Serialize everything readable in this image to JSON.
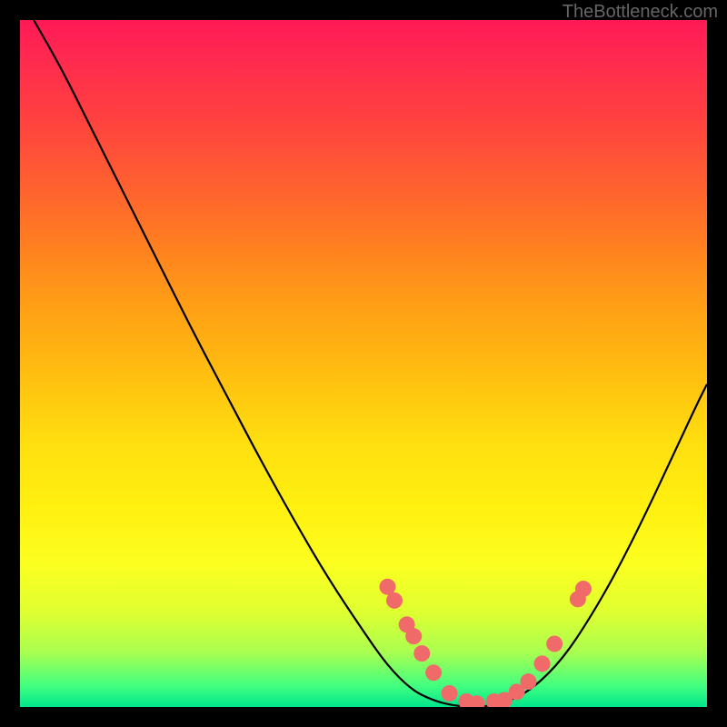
{
  "watermark": "TheBottleneck.com",
  "chart_data": {
    "type": "line",
    "title": "",
    "xlabel": "",
    "ylabel": "",
    "xlim": [
      0,
      1
    ],
    "ylim": [
      0,
      1
    ],
    "curve": [
      {
        "x": 0.02,
        "y": 1.0
      },
      {
        "x": 0.06,
        "y": 0.93
      },
      {
        "x": 0.1,
        "y": 0.85
      },
      {
        "x": 0.15,
        "y": 0.75
      },
      {
        "x": 0.2,
        "y": 0.65
      },
      {
        "x": 0.25,
        "y": 0.55
      },
      {
        "x": 0.3,
        "y": 0.455
      },
      {
        "x": 0.35,
        "y": 0.36
      },
      {
        "x": 0.4,
        "y": 0.27
      },
      {
        "x": 0.45,
        "y": 0.185
      },
      {
        "x": 0.5,
        "y": 0.11
      },
      {
        "x": 0.535,
        "y": 0.06
      },
      {
        "x": 0.57,
        "y": 0.025
      },
      {
        "x": 0.6,
        "y": 0.01
      },
      {
        "x": 0.63,
        "y": 0.002
      },
      {
        "x": 0.66,
        "y": 0.0
      },
      {
        "x": 0.69,
        "y": 0.002
      },
      {
        "x": 0.72,
        "y": 0.012
      },
      {
        "x": 0.75,
        "y": 0.03
      },
      {
        "x": 0.79,
        "y": 0.07
      },
      {
        "x": 0.83,
        "y": 0.13
      },
      {
        "x": 0.87,
        "y": 0.2
      },
      {
        "x": 0.91,
        "y": 0.28
      },
      {
        "x": 0.95,
        "y": 0.365
      },
      {
        "x": 0.985,
        "y": 0.44
      },
      {
        "x": 1.0,
        "y": 0.47
      }
    ],
    "markers": [
      {
        "x": 0.535,
        "y": 0.175
      },
      {
        "x": 0.545,
        "y": 0.155
      },
      {
        "x": 0.563,
        "y": 0.12
      },
      {
        "x": 0.573,
        "y": 0.103
      },
      {
        "x": 0.585,
        "y": 0.078
      },
      {
        "x": 0.602,
        "y": 0.05
      },
      {
        "x": 0.625,
        "y": 0.02
      },
      {
        "x": 0.65,
        "y": 0.008
      },
      {
        "x": 0.665,
        "y": 0.005
      },
      {
        "x": 0.69,
        "y": 0.008
      },
      {
        "x": 0.705,
        "y": 0.01
      },
      {
        "x": 0.723,
        "y": 0.022
      },
      {
        "x": 0.74,
        "y": 0.037
      },
      {
        "x": 0.76,
        "y": 0.063
      },
      {
        "x": 0.778,
        "y": 0.092
      },
      {
        "x": 0.812,
        "y": 0.157
      },
      {
        "x": 0.82,
        "y": 0.172
      }
    ],
    "marker_color": "#f06a6a",
    "marker_radius": 9,
    "curve_stroke": "#000000",
    "curve_width": 2.2
  }
}
